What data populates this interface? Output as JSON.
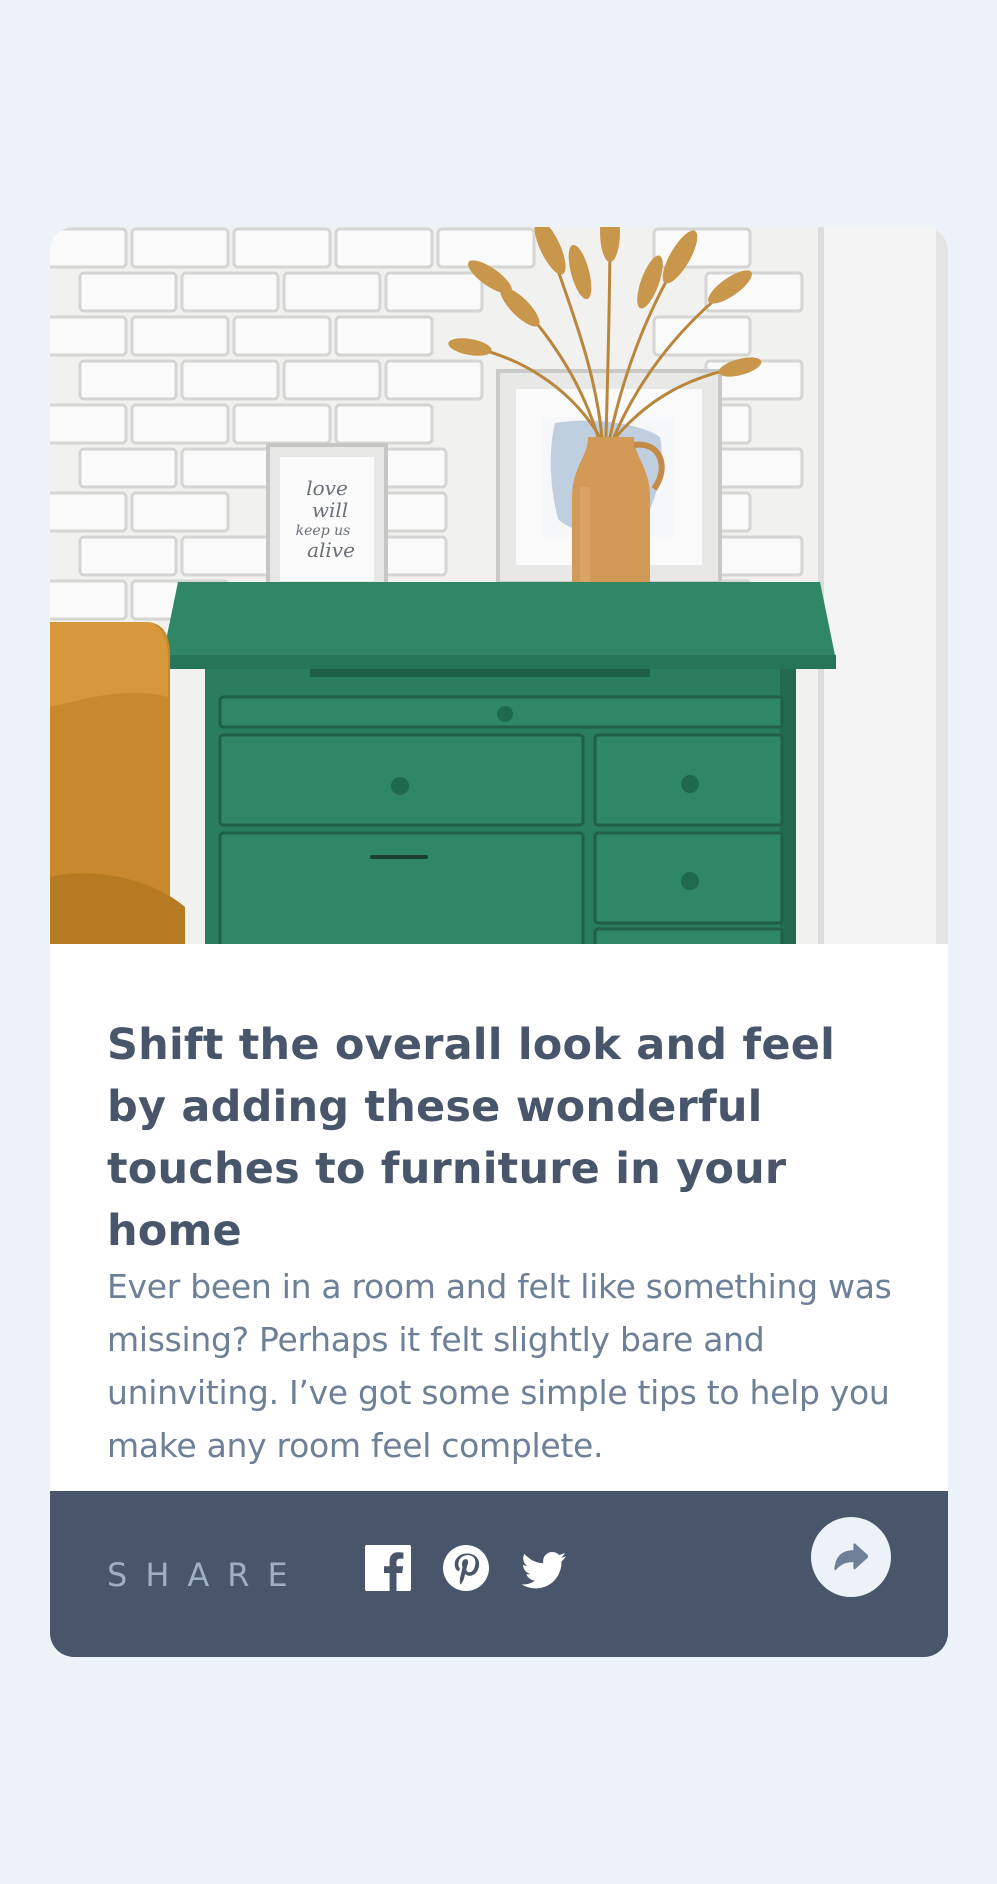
{
  "article": {
    "image_alt": "Green drawer chest with framed print and vase of dried grass against a white brick wall",
    "print_text": "love will keep us alive",
    "title": "Shift the overall look and feel by adding these wonderful touches to furniture in your home",
    "description": "Ever been in a room and felt like something was missing? Perhaps it felt slightly bare and uninviting. I’ve got some simple tips to help you make any room feel complete."
  },
  "share": {
    "label": "SHARE",
    "icons": [
      "facebook-icon",
      "pinterest-icon",
      "twitter-icon"
    ],
    "button_icon": "share-arrow-icon"
  },
  "colors": {
    "page_background": "#ecf2f8",
    "card_background": "#ffffff",
    "title": "#48556a",
    "description": "#6e8098",
    "share_bar": "#48556a",
    "share_label": "#9eafc2",
    "share_button": "#ecf2f8"
  }
}
